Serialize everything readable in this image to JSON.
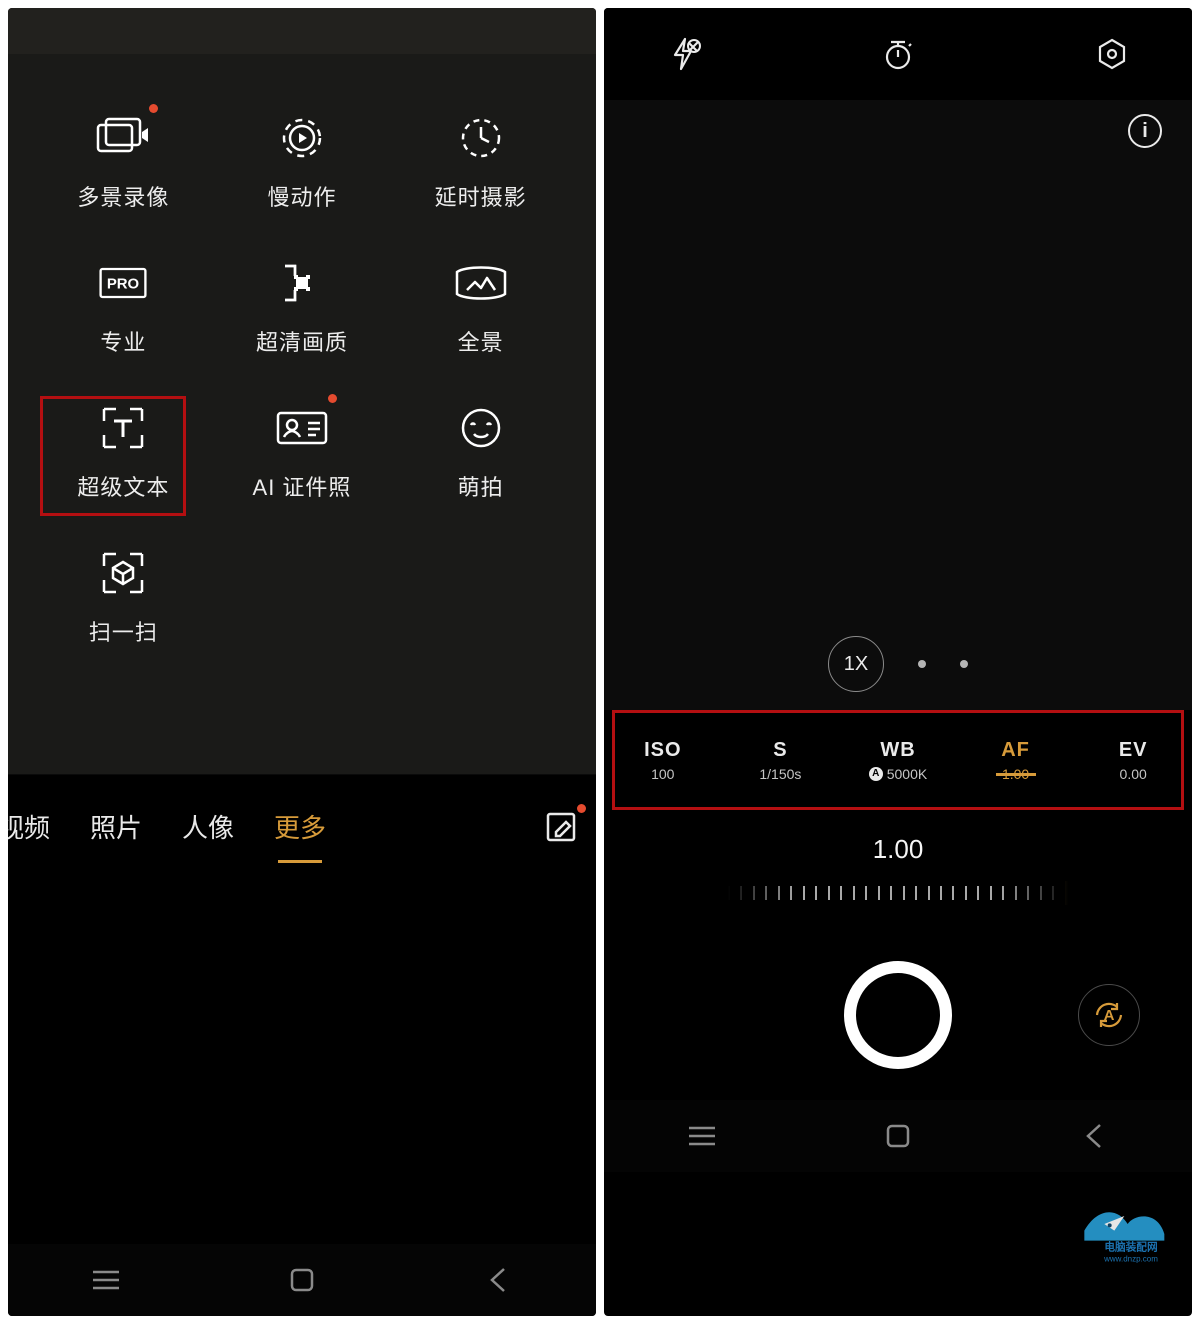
{
  "left": {
    "modes": [
      {
        "key": "multi-record",
        "label": "多景录像",
        "badge": true
      },
      {
        "key": "slow-motion",
        "label": "慢动作",
        "badge": false
      },
      {
        "key": "timelapse",
        "label": "延时摄影",
        "badge": false
      },
      {
        "key": "pro",
        "label": "专业",
        "badge": false,
        "pro_text": "PRO"
      },
      {
        "key": "ultra-hd",
        "label": "超清画质",
        "badge": false
      },
      {
        "key": "panorama",
        "label": "全景",
        "badge": false
      },
      {
        "key": "super-text",
        "label": "超级文本",
        "badge": false
      },
      {
        "key": "ai-id-photo",
        "label": "AI 证件照",
        "badge": true
      },
      {
        "key": "moe-capture",
        "label": "萌拍",
        "badge": false
      },
      {
        "key": "scan",
        "label": "扫一扫",
        "badge": false
      }
    ],
    "tabs": {
      "video": "视频",
      "photo": "照片",
      "portrait": "人像",
      "more": "更多"
    },
    "active_tab": "more"
  },
  "right": {
    "top_icons": [
      "flash-off",
      "timer",
      "hex-settings"
    ],
    "info_glyph": "i",
    "zoom": {
      "current": "1X"
    },
    "pro_params": [
      {
        "key": "iso",
        "title": "ISO",
        "value": "100",
        "active": false
      },
      {
        "key": "shutter",
        "title": "S",
        "value": "1/150s",
        "active": false
      },
      {
        "key": "wb",
        "title": "WB",
        "value": "5000K",
        "prefix": "A",
        "active": false
      },
      {
        "key": "af",
        "title": "AF",
        "value": "1.00",
        "active": true
      },
      {
        "key": "ev",
        "title": "EV",
        "value": "0.00",
        "active": false
      }
    ],
    "slider_value": "1.00",
    "cycle_label": "A"
  },
  "watermark": {
    "line1": "电脑装配网",
    "line2": "www.dnzp.com"
  }
}
